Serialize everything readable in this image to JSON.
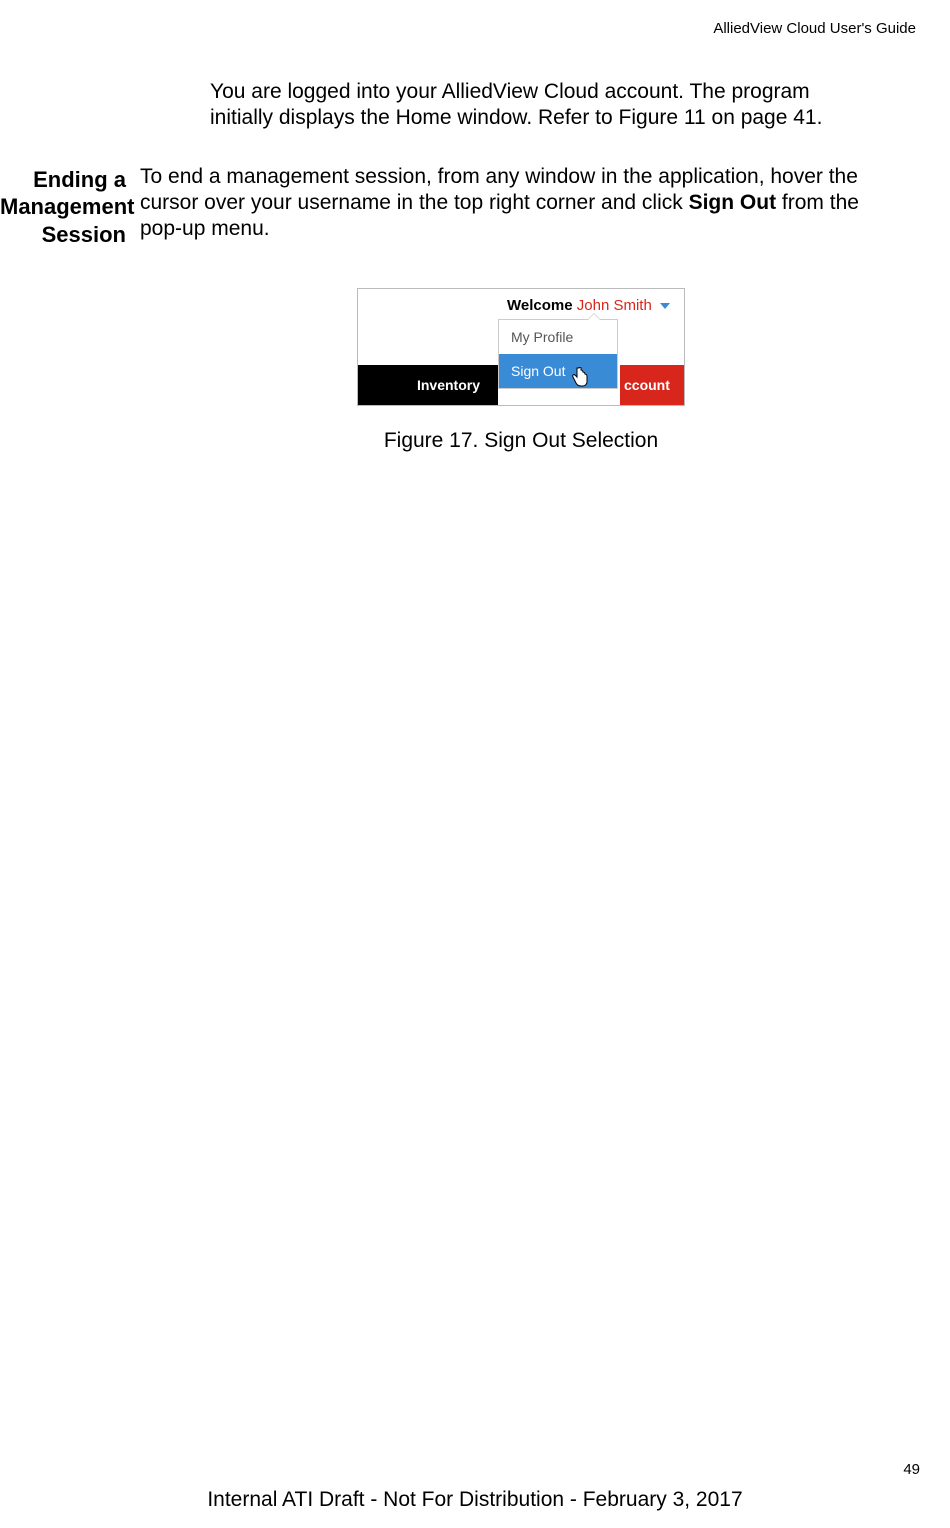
{
  "header": {
    "title": "AlliedView Cloud User's Guide"
  },
  "intro": {
    "text": "You are logged into your AlliedView Cloud account. The program initially displays the Home window. Refer to Figure 11 on page 41."
  },
  "section": {
    "heading": "Ending a Management Session",
    "body_prefix": "To end a management session, from any window in the application, hover the cursor over your username in the top right corner and click ",
    "body_bold": "Sign Out",
    "body_suffix": " from the pop-up menu."
  },
  "ui": {
    "welcome_label": "Welcome",
    "username": "John Smith",
    "nav": {
      "inventory": "Inventory",
      "account_fragment": "ccount"
    },
    "dropdown": {
      "my_profile": "My Profile",
      "sign_out": "Sign Out"
    }
  },
  "figure": {
    "caption": "Figure 17. Sign Out Selection"
  },
  "footer": {
    "page_number": "49",
    "note": "Internal ATI Draft - Not For Distribution - February 3, 2017"
  }
}
